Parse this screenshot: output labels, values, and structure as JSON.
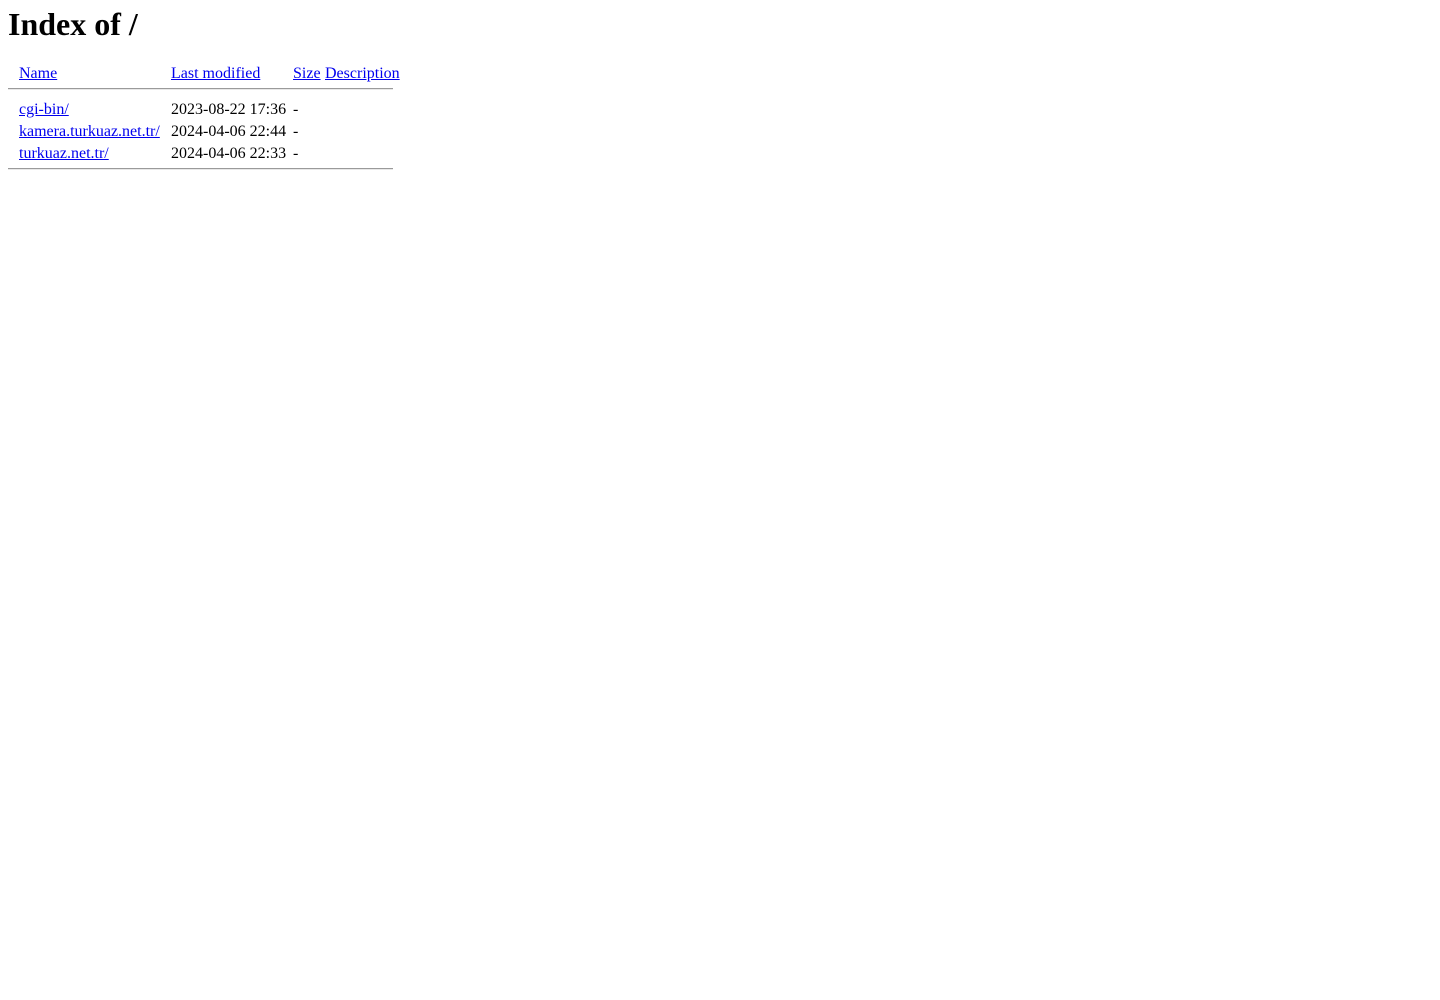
{
  "page": {
    "title": "Index of /",
    "server_style": "apache-fancy-index",
    "background_color": "#ffffff",
    "link_color": "#0000EE",
    "rule_color": "#9a9a9a"
  },
  "table": {
    "columns": [
      {
        "key": "name",
        "label": "Name"
      },
      {
        "key": "last_modified",
        "label": "Last modified"
      },
      {
        "key": "size",
        "label": "Size"
      },
      {
        "key": "description",
        "label": "Description"
      }
    ],
    "rows": [
      {
        "name": "cgi-bin/",
        "last_modified": "2023-08-22 17:36",
        "size": "-",
        "description": ""
      },
      {
        "name": "kamera.turkuaz.net.tr/",
        "last_modified": "2024-04-06 22:44",
        "size": "-",
        "description": ""
      },
      {
        "name": "turkuaz.net.tr/",
        "last_modified": "2024-04-06 22:33",
        "size": "-",
        "description": ""
      }
    ]
  }
}
